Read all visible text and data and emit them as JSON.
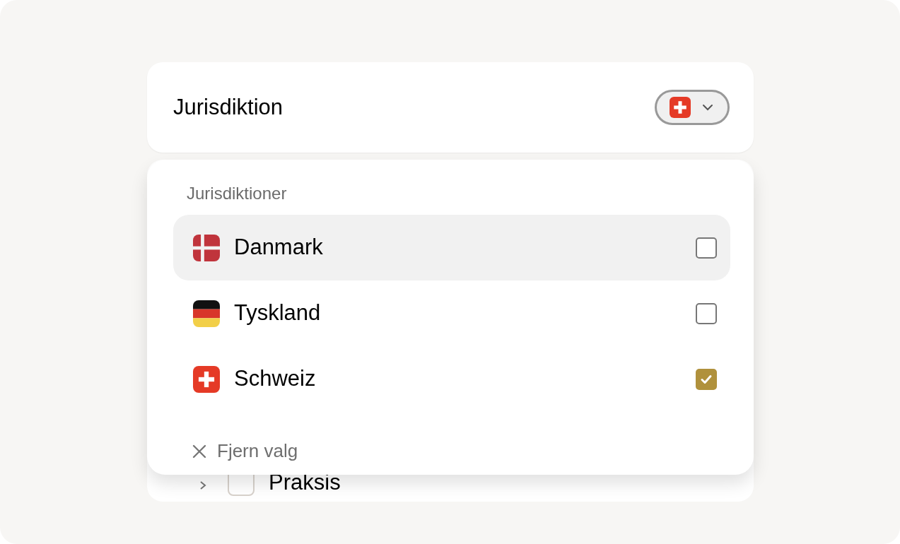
{
  "header": {
    "title": "Jurisdiktion",
    "selector": {
      "kind": "ch",
      "expanded": true
    }
  },
  "menu": {
    "heading": "Jurisdiktioner",
    "options": [
      {
        "label": "Danmark",
        "kind": "dk",
        "highlighted": true,
        "checked": false
      },
      {
        "label": "Tyskland",
        "kind": "de",
        "highlighted": false,
        "checked": false
      },
      {
        "label": "Schweiz",
        "kind": "ch",
        "highlighted": false,
        "checked": true
      }
    ],
    "clear": "Fjern valg"
  },
  "behind": {
    "label": "Praksis",
    "checked": false
  }
}
